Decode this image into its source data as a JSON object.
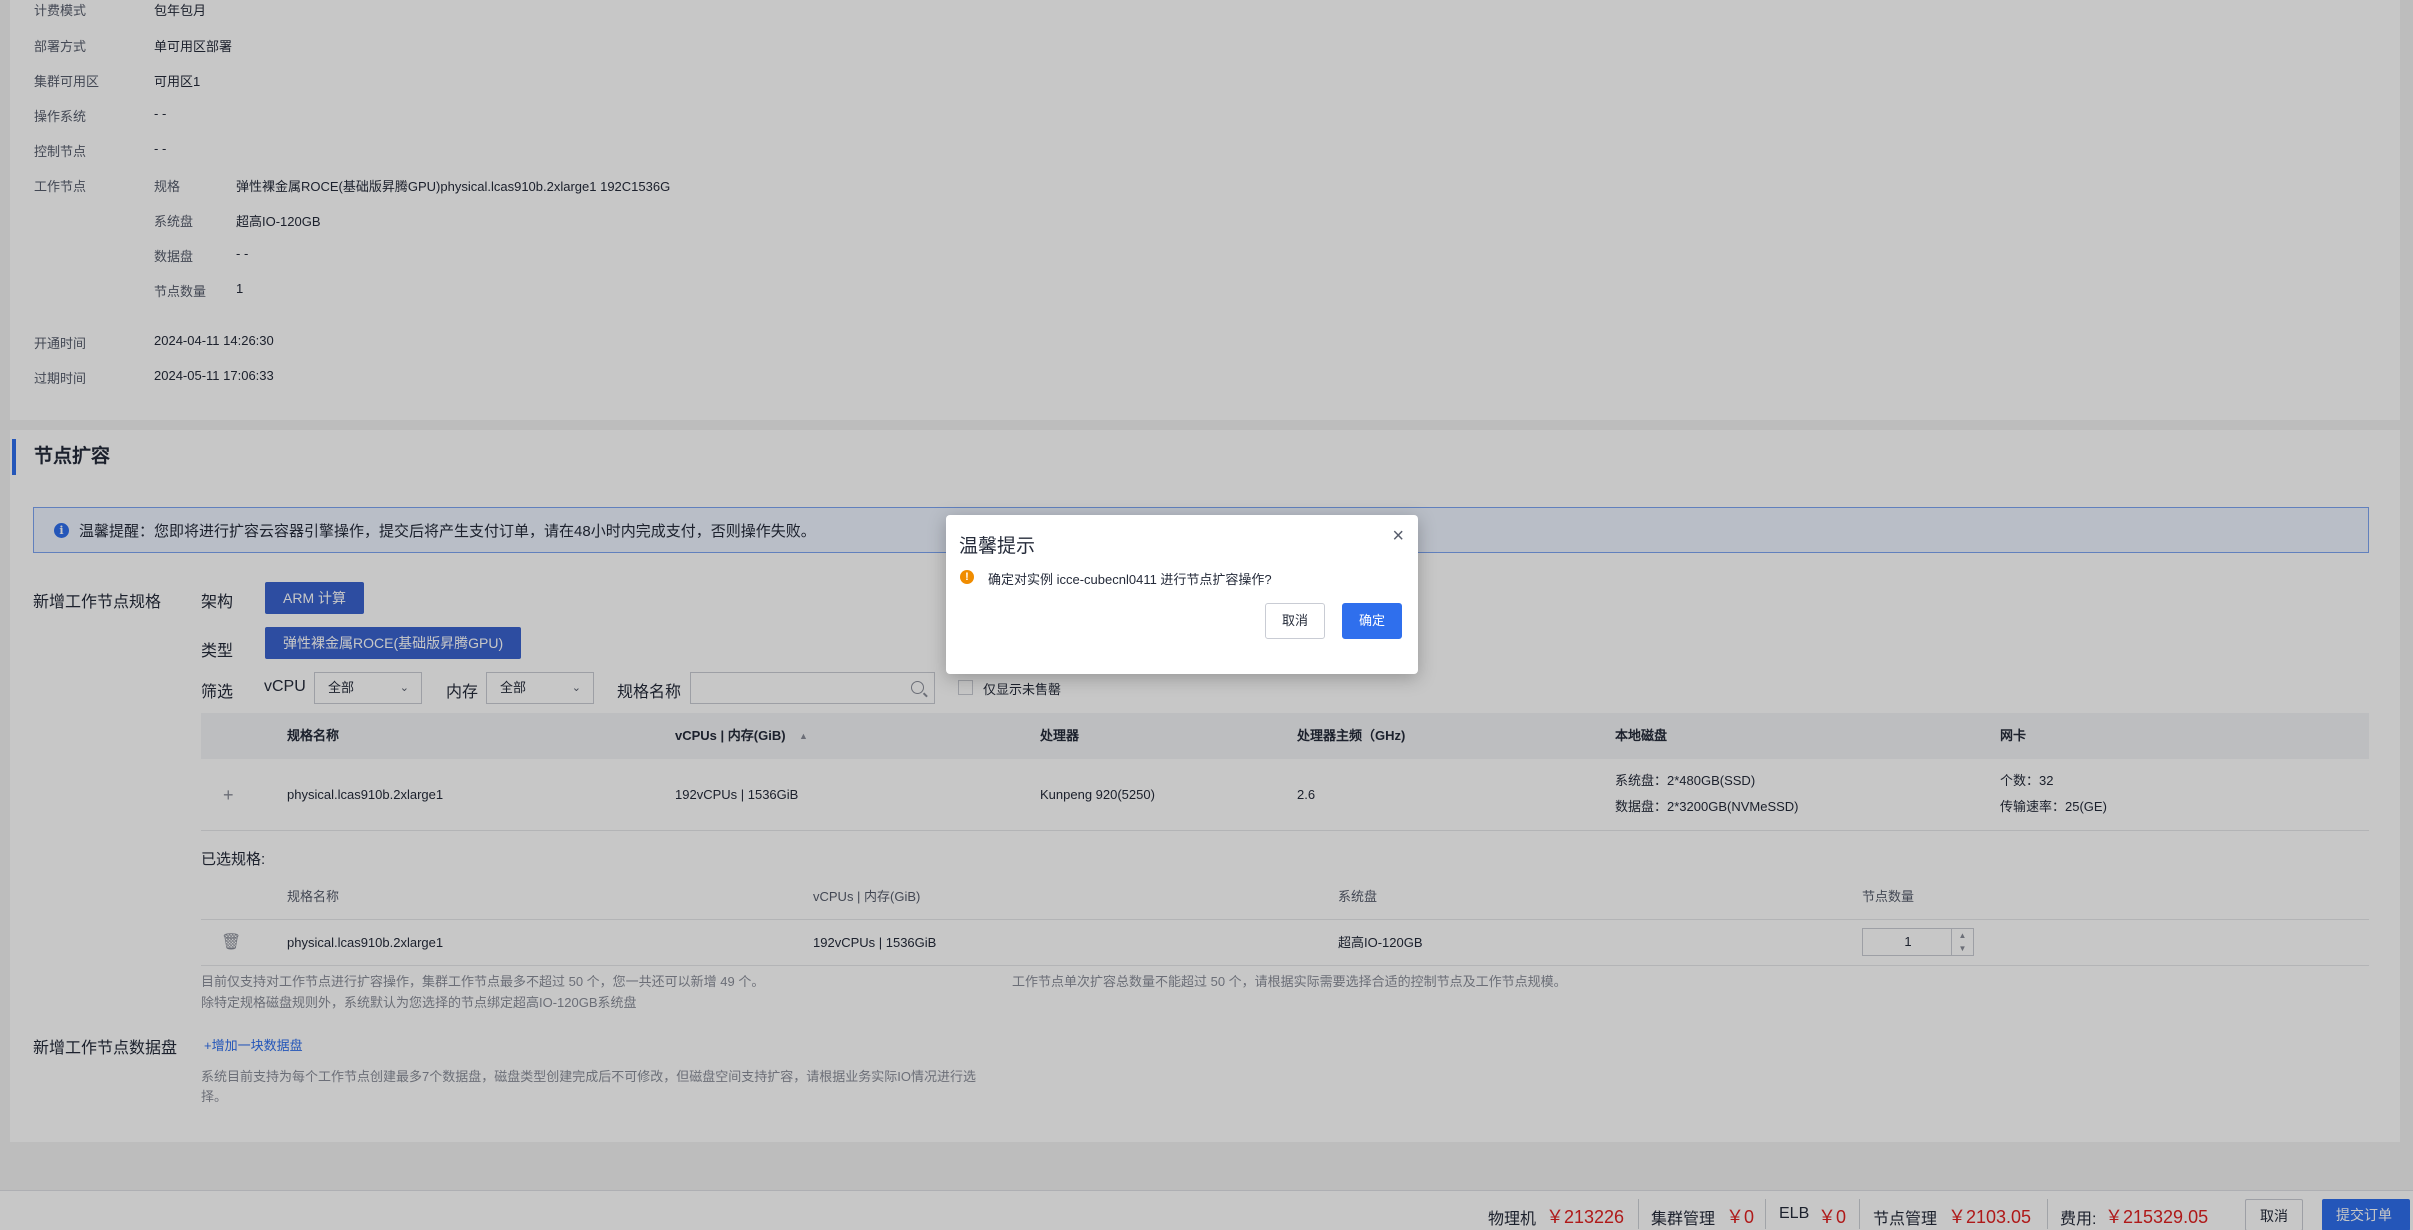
{
  "order_info": {
    "billing_mode": {
      "label": "计费模式",
      "value": "包年包月"
    },
    "deploy_mode": {
      "label": "部署方式",
      "value": "单可用区部署"
    },
    "az": {
      "label": "集群可用区",
      "value": "可用区1"
    },
    "os": {
      "label": "操作系统",
      "value": "- -"
    },
    "control_node": {
      "label": "控制节点",
      "value": "- -"
    },
    "worker_node": {
      "label": "工作节点",
      "spec": {
        "label": "规格",
        "value": "弹性裸金属ROCE(基础版昇腾GPU)physical.lcas910b.2xlarge1 192C1536G"
      },
      "system_disk": {
        "label": "系统盘",
        "value": "超高IO-120GB"
      },
      "data_disk": {
        "label": "数据盘",
        "value": "- -"
      },
      "node_count": {
        "label": "节点数量",
        "value": "1"
      }
    },
    "open_time": {
      "label": "开通时间",
      "value": "2024-04-11 14:26:30"
    },
    "expire_time": {
      "label": "过期时间",
      "value": "2024-05-11 17:06:33"
    }
  },
  "section_title": "节点扩容",
  "alert": {
    "text": "温馨提醒：您即将进行扩容云容器引擎操作，提交后将产生支付订单，请在48小时内完成支付，否则操作失败。"
  },
  "form": {
    "new_spec_label": "新增工作节点规格",
    "arch_label": "架构",
    "arch_value": "ARM 计算",
    "type_label": "类型",
    "type_value": "弹性裸金属ROCE(基础版昇腾GPU)",
    "filter_label": "筛选",
    "vcpu_label": "vCPU",
    "vcpu_value": "全部",
    "mem_label": "内存",
    "mem_value": "全部",
    "spec_name_label": "规格名称",
    "spec_name_placeholder": "",
    "unsold_label": "仅显示未售罄"
  },
  "spec_table": {
    "headers": [
      "规格名称",
      "vCPUs | 内存(GiB)",
      "处理器",
      "处理器主频（GHz)",
      "本地磁盘",
      "网卡"
    ],
    "row": {
      "name": "physical.lcas910b.2xlarge1",
      "vcpu_mem": "192vCPUs | 1536GiB",
      "cpu": "Kunpeng 920(5250)",
      "freq": "2.6",
      "disk1": "系统盘：2*480GB(SSD)",
      "disk2": "数据盘：2*3200GB(NVMeSSD)",
      "nic1": "个数：32",
      "nic2": "传输速率：25(GE)"
    }
  },
  "selected": {
    "label": "已选规格:",
    "headers": [
      "规格名称",
      "vCPUs | 内存(GiB)",
      "系统盘",
      "节点数量"
    ],
    "row": {
      "name": "physical.lcas910b.2xlarge1",
      "vcpu_mem": "192vCPUs | 1536GiB",
      "disk": "超高IO-120GB",
      "count": "1"
    }
  },
  "notes": {
    "n1": "目前仅支持对工作节点进行扩容操作，集群工作节点最多不超过 50 个，您一共还可以新增 49 个。",
    "n2": "除特定规格磁盘规则外，系统默认为您选择的节点绑定超高IO-120GB系统盘",
    "n3": "工作节点单次扩容总数量不能超过 50 个，请根据实际需要选择合适的控制节点及工作节点规模。"
  },
  "data_disk": {
    "label": "新增工作节点数据盘",
    "add_link": "+增加一块数据盘",
    "note_line1": "系统目前支持为每个工作节点创建最多7个数据盘，磁盘类型创建完成后不可修改，但磁盘空间支持扩容，请根据业务实际IO情况进行选",
    "note_line2": "择。"
  },
  "footer": {
    "physical_label": "物理机",
    "physical_price": "￥213226",
    "cluster_label": "集群管理",
    "cluster_price": "￥0",
    "elb_label": "ELB",
    "elb_price": "￥0",
    "node_label": "节点管理",
    "node_price": "￥2103.05",
    "total_label": "费用:",
    "total_price": "￥215329.05",
    "cancel": "取消",
    "submit": "提交订单"
  },
  "modal": {
    "title": "温馨提示",
    "message": "确定对实例 icce-cubecnl0411 进行节点扩容操作?",
    "cancel": "取消",
    "confirm": "确定"
  },
  "colors": {
    "accent": "#2f6fed",
    "price": "#e02020",
    "warning": "#f08c00"
  }
}
